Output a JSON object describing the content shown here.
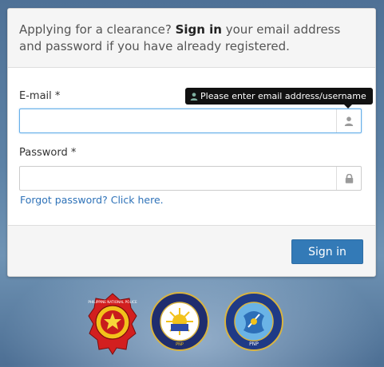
{
  "panel": {
    "heading": {
      "prefix": "Applying for a clearance? ",
      "emphasis": "Sign in",
      "suffix": " your email address and password if you have already registered."
    }
  },
  "form": {
    "email_label": "E-mail *",
    "email_value": "",
    "email_icon": "user-icon",
    "password_label": "Password *",
    "password_value": "",
    "password_icon": "lock-icon",
    "tooltip_text": "Please enter email address/username",
    "forgot_link": "Forgot password? Click here.",
    "submit_label": "Sign in"
  },
  "logos": [
    {
      "name": "philippine-national-police-seal",
      "text": "PHILIPPINE NATIONAL POLICE"
    },
    {
      "name": "directorate-investigation-detective-management-seal",
      "text": "DIRECTORATE FOR INVESTIGATION AND DETECTIVE MANAGEMENT",
      "sub": "PNP"
    },
    {
      "name": "information-technology-management-seal",
      "text": "INFORMATION TECHNOLOGY MANAGEMENT",
      "sub": "PNP"
    }
  ],
  "colors": {
    "primary": "#337ab7",
    "link": "#2e72b8",
    "tooltip_bg": "#111111",
    "focus_border": "#66afe9"
  }
}
